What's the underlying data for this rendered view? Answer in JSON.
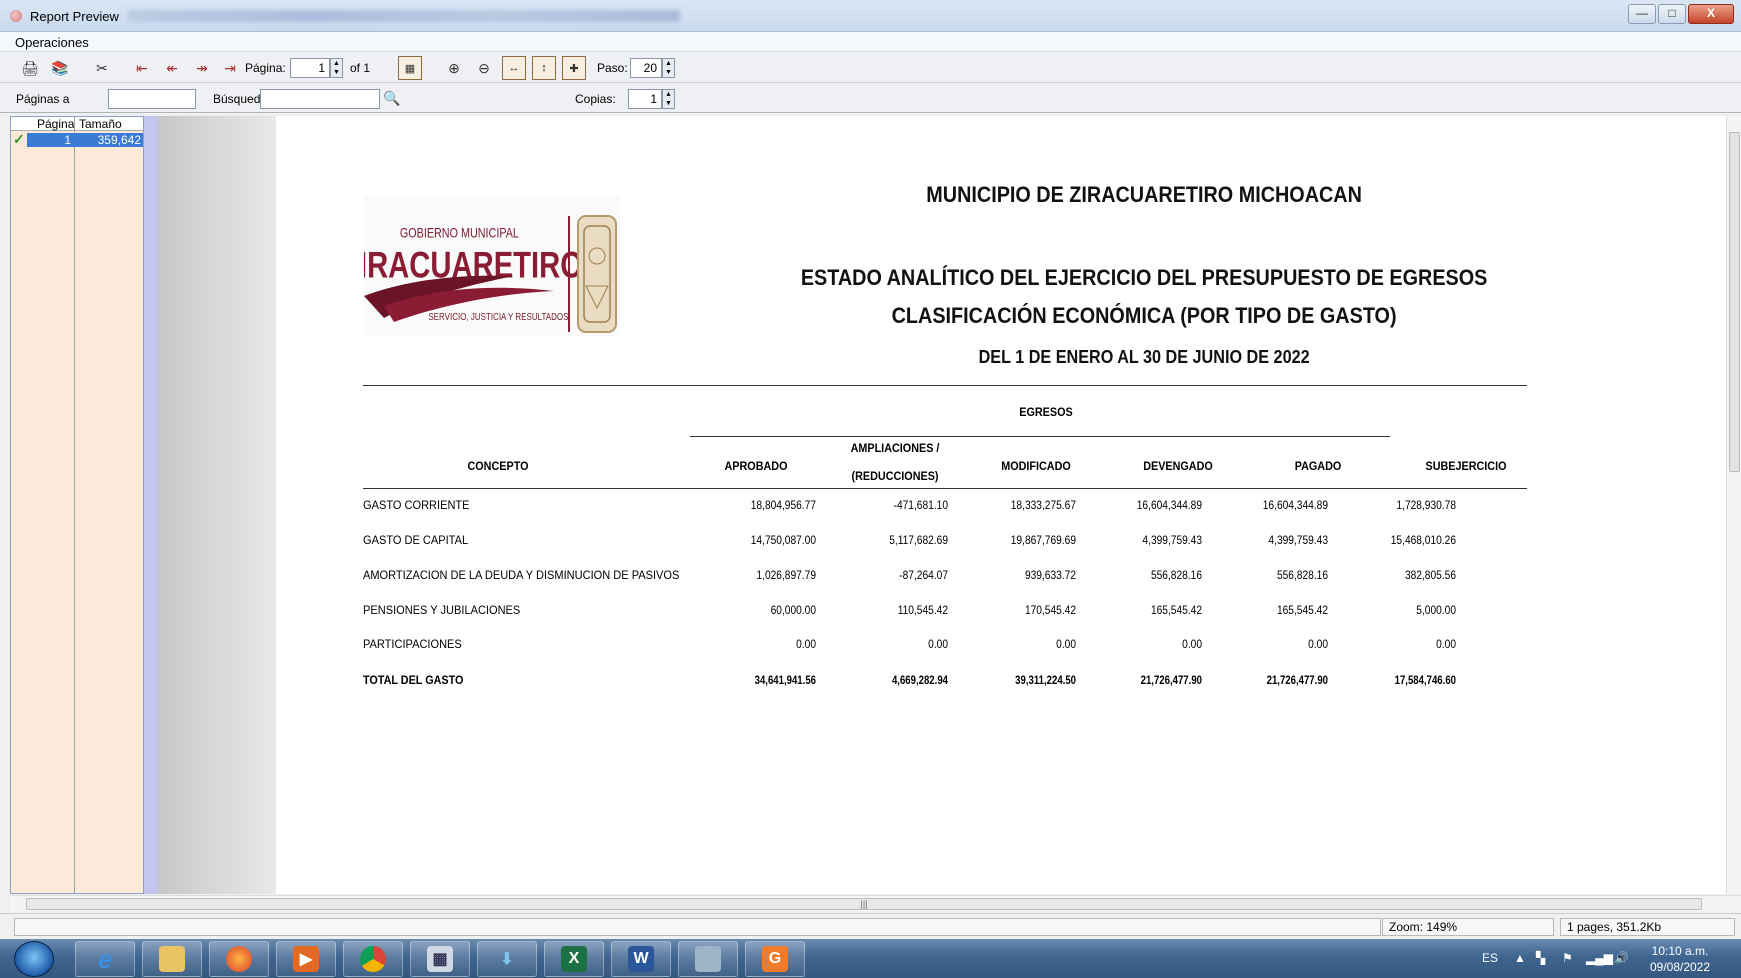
{
  "window": {
    "title": "Report Preview",
    "minimize": "—",
    "maximize": "□",
    "close": "X"
  },
  "menu": {
    "operaciones": "Operaciones"
  },
  "toolbar": {
    "pagina_label": "Página:",
    "pagina_value": "1",
    "of_label": "of 1",
    "paso_label": "Paso:",
    "paso_value": "20",
    "paginas_a_label": "Páginas a",
    "busqueda_label": "Búsqued",
    "copias_label": "Copias:",
    "copias_value": "1"
  },
  "sidebar": {
    "col_pagina": "Página",
    "col_tamano": "Tamaño",
    "rows": [
      {
        "pagina": "1",
        "tamano": "359,642"
      }
    ]
  },
  "status": {
    "zoom": "Zoom: 149%",
    "pages": "1 pages, 351.2Kb"
  },
  "taskbar": {
    "lang": "ES",
    "time": "10:10 a.m.",
    "date": "09/08/2022"
  },
  "report": {
    "logo": {
      "top": "GOBIERNO MUNICIPAL",
      "name": "ZIRACUARETIRO",
      "slogan": "SERVICIO, JUSTICIA Y RESULTADOS"
    },
    "title1": "MUNICIPIO DE ZIRACUARETIRO MICHOACAN",
    "title2": "ESTADO ANALÍTICO DEL EJERCICIO DEL PRESUPUESTO DE EGRESOS",
    "title3": "CLASIFICACIÓN ECONÓMICA (POR TIPO DE GASTO)",
    "title4": "DEL 1 DE ENERO AL 30 DE JUNIO DE 2022",
    "egresos": "EGRESOS",
    "headers": {
      "concepto": "CONCEPTO",
      "aprobado": "APROBADO",
      "ampliaciones1": "AMPLIACIONES /",
      "ampliaciones2": "(REDUCCIONES)",
      "modificado": "MODIFICADO",
      "devengado": "DEVENGADO",
      "pagado": "PAGADO",
      "subejercicio": "SUBEJERCICIO"
    },
    "rows": [
      {
        "concepto": "GASTO CORRIENTE",
        "aprobado": "18,804,956.77",
        "ampliaciones": "-471,681.10",
        "modificado": "18,333,275.67",
        "devengado": "16,604,344.89",
        "pagado": "16,604,344.89",
        "subejercicio": "1,728,930.78"
      },
      {
        "concepto": "GASTO DE CAPITAL",
        "aprobado": "14,750,087.00",
        "ampliaciones": "5,117,682.69",
        "modificado": "19,867,769.69",
        "devengado": "4,399,759.43",
        "pagado": "4,399,759.43",
        "subejercicio": "15,468,010.26"
      },
      {
        "concepto": "AMORTIZACION DE LA DEUDA Y DISMINUCION DE PASIVOS",
        "aprobado": "1,026,897.79",
        "ampliaciones": "-87,264.07",
        "modificado": "939,633.72",
        "devengado": "556,828.16",
        "pagado": "556,828.16",
        "subejercicio": "382,805.56"
      },
      {
        "concepto": "PENSIONES Y JUBILACIONES",
        "aprobado": "60,000.00",
        "ampliaciones": "110,545.42",
        "modificado": "170,545.42",
        "devengado": "165,545.42",
        "pagado": "165,545.42",
        "subejercicio": "5,000.00"
      },
      {
        "concepto": "PARTICIPACIONES",
        "aprobado": "0.00",
        "ampliaciones": "0.00",
        "modificado": "0.00",
        "devengado": "0.00",
        "pagado": "0.00",
        "subejercicio": "0.00"
      }
    ],
    "total": {
      "concepto": "TOTAL DEL GASTO",
      "aprobado": "34,641,941.56",
      "ampliaciones": "4,669,282.94",
      "modificado": "39,311,224.50",
      "devengado": "21,726,477.90",
      "pagado": "21,726,477.90",
      "subejercicio": "17,584,746.60"
    }
  },
  "colors": {
    "logo_wine": "#8a1c34",
    "selection": "#3a7bd5",
    "sidebar_bg": "#fde9da"
  }
}
